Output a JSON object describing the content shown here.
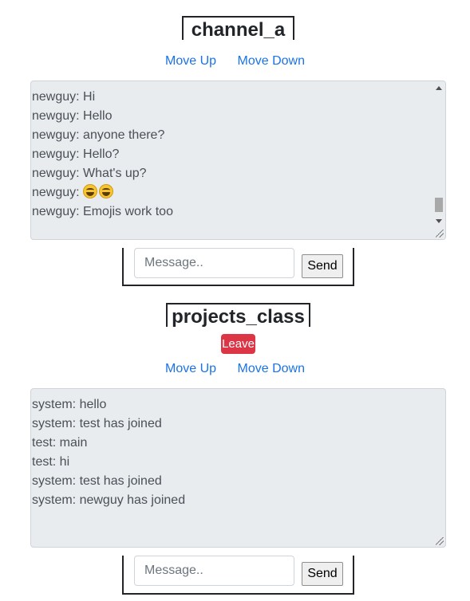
{
  "channels": [
    {
      "name": "channel_a",
      "move_up": "Move Up",
      "move_down": "Move Down",
      "messages": [
        "newguy: Hi",
        "newguy: Hello",
        "newguy: anyone there?",
        "newguy: Hello?",
        "newguy: What's up?",
        "newguy: ",
        "newguy: Emojis work too"
      ],
      "emoji_message": {
        "prefix": "newguy: ",
        "emojis": [
          "grinning-squinting-face",
          "grinning-squinting-face"
        ]
      },
      "input_placeholder": "Message..",
      "send_label": "Send"
    },
    {
      "name": "projects_class",
      "leave_label": "Leave",
      "move_up": "Move Up",
      "move_down": "Move Down",
      "messages": [
        "system: hello",
        "system: test has joined",
        "test: main",
        "test: hi",
        "system: test has joined",
        "system: newguy has joined"
      ],
      "input_placeholder": "Message..",
      "send_label": "Send"
    }
  ],
  "colors": {
    "link": "#1a73e8",
    "leave_button": "#dc3545",
    "chat_background": "#e9ecef"
  }
}
